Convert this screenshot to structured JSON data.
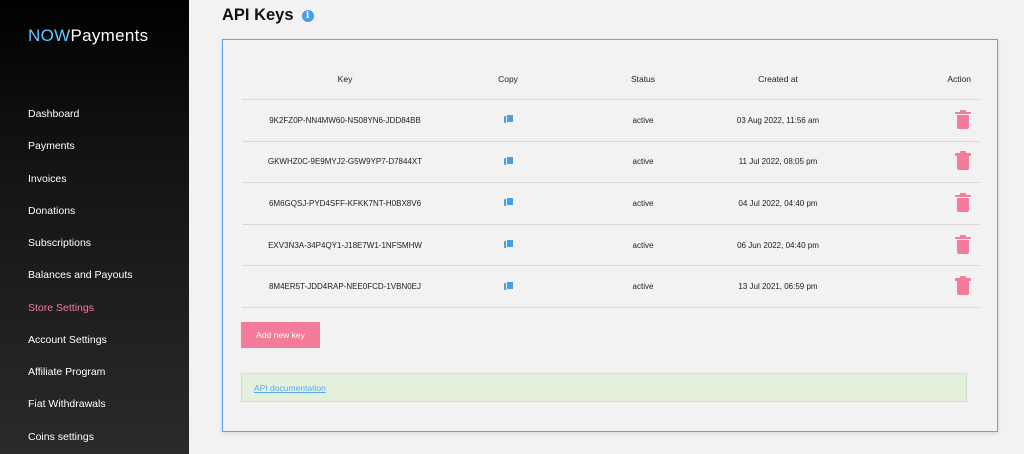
{
  "brand": {
    "now": "NOW",
    "payments": "Payments"
  },
  "sidebar": {
    "items": [
      {
        "label": "Dashboard"
      },
      {
        "label": "Payments"
      },
      {
        "label": "Invoices"
      },
      {
        "label": "Donations"
      },
      {
        "label": "Subscriptions"
      },
      {
        "label": "Balances and Payouts"
      },
      {
        "label": "Store Settings",
        "active": true
      },
      {
        "label": "Account Settings"
      },
      {
        "label": "Affiliate Program"
      },
      {
        "label": "Fiat Withdrawals"
      },
      {
        "label": "Coins settings"
      }
    ]
  },
  "page": {
    "title": "API Keys",
    "info_icon": "i"
  },
  "table": {
    "headers": {
      "key": "Key",
      "copy": "Copy",
      "status": "Status",
      "created": "Created at",
      "action": "Action"
    },
    "rows": [
      {
        "key": "9K2FZ0P-NN4MW60-NS08YN6-JDD84BB",
        "status": "active",
        "created": "03 Aug 2022, 11:56 am"
      },
      {
        "key": "GKWHZ0C-9E9MYJ2-G5W9YP7-D7844XT",
        "status": "active",
        "created": "11 Jul 2022, 08:05 pm"
      },
      {
        "key": "6M6GQSJ-PYD4SFF-KFKK7NT-H0BX8V6",
        "status": "active",
        "created": "04 Jul 2022, 04:40 pm"
      },
      {
        "key": "EXV3N3A-34P4QY1-J18E7W1-1NFSMHW",
        "status": "active",
        "created": "06 Jun 2022, 04:40 pm"
      },
      {
        "key": "8M4ER5T-JDD4RAP-NEE0FCD-1VBN0EJ",
        "status": "active",
        "created": "13 Jul 2021, 06:59 pm"
      }
    ]
  },
  "buttons": {
    "add_new_key": "Add new key"
  },
  "docs": {
    "link": "API documentation"
  },
  "colors": {
    "accent_pink": "#f47c9a",
    "accent_blue": "#4a9ee8",
    "panel_border": "#5ba8ee",
    "doc_bg": "#e3f1dc"
  }
}
